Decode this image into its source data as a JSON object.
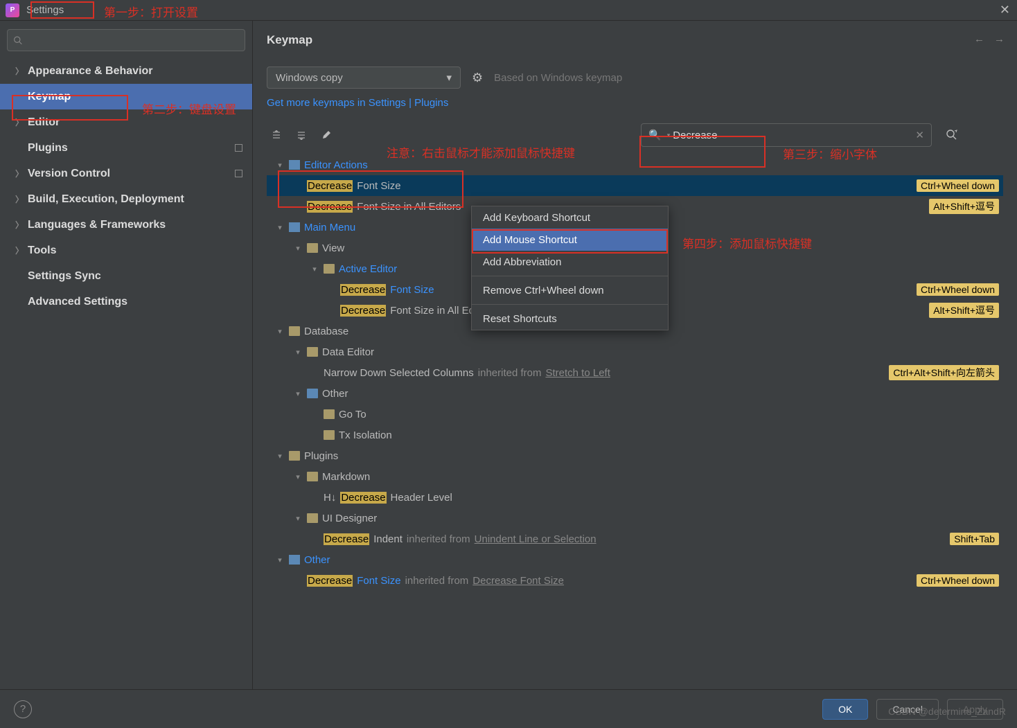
{
  "title": "Settings",
  "annotations": {
    "step1": "第一步：打开设置",
    "step2": "第二步：键盘设置",
    "step3": "第三步：缩小字体",
    "step4": "第四步：添加鼠标快捷键",
    "note": "注意：右击鼠标才能添加鼠标快捷键"
  },
  "sidebar": {
    "items": [
      {
        "label": "Appearance & Behavior",
        "exp": true,
        "bold": true
      },
      {
        "label": "Keymap",
        "exp": false,
        "bold": true,
        "selected": true,
        "pad": true
      },
      {
        "label": "Editor",
        "exp": true,
        "bold": true
      },
      {
        "label": "Plugins",
        "exp": false,
        "bold": true,
        "pad": true,
        "sq": true
      },
      {
        "label": "Version Control",
        "exp": true,
        "bold": true,
        "sq": true
      },
      {
        "label": "Build, Execution, Deployment",
        "exp": true,
        "bold": true
      },
      {
        "label": "Languages & Frameworks",
        "exp": true,
        "bold": true
      },
      {
        "label": "Tools",
        "exp": true,
        "bold": true
      },
      {
        "label": "Settings Sync",
        "exp": false,
        "bold": true,
        "pad": true
      },
      {
        "label": "Advanced Settings",
        "exp": false,
        "bold": true,
        "pad": true
      }
    ]
  },
  "content": {
    "heading": "Keymap",
    "select": "Windows copy",
    "based": "Based on Windows keymap",
    "link": "Get more keymaps in Settings | Plugins",
    "search": "Decrease"
  },
  "tree": [
    {
      "ind": 0,
      "tw": "▾",
      "icon": "cat",
      "text": "Editor Actions",
      "blue": true
    },
    {
      "ind": 1,
      "hl": "Decrease",
      "text": " Font Size",
      "sel": true,
      "short": "Ctrl+Wheel down"
    },
    {
      "ind": 1,
      "hl": "Decrease",
      "text": " Font Size in All Editors",
      "short": "Alt+Shift+逗号"
    },
    {
      "ind": 0,
      "tw": "▾",
      "icon": "cat",
      "text": "Main Menu",
      "blue": true
    },
    {
      "ind": 1,
      "tw": "▾",
      "icon": "folder",
      "text": "View"
    },
    {
      "ind": 2,
      "tw": "▾",
      "icon": "folder",
      "text": "Active Editor",
      "blue": true
    },
    {
      "ind": 3,
      "hl": "Decrease",
      "text2": " Font Size",
      "blue2": true,
      "short": "Ctrl+Wheel down"
    },
    {
      "ind": 3,
      "hl": "Decrease",
      "text": " Font Size in All Editors",
      "short": "Alt+Shift+逗号"
    },
    {
      "ind": 0,
      "tw": "▾",
      "icon": "folder",
      "text": "Database"
    },
    {
      "ind": 1,
      "tw": "▾",
      "icon": "folder",
      "text": "Data Editor"
    },
    {
      "ind": 2,
      "text": "Narrow Down Selected Columns ",
      "grey": "inherited from ",
      "under": "Stretch to Left",
      "short": "Ctrl+Alt+Shift+向左箭头"
    },
    {
      "ind": 1,
      "tw": "▾",
      "icon": "folder-blue",
      "text": "Other"
    },
    {
      "ind": 2,
      "icon": "folder",
      "text": "Go To"
    },
    {
      "ind": 2,
      "icon": "folder",
      "text": "Tx Isolation"
    },
    {
      "ind": 0,
      "tw": "▾",
      "icon": "folder",
      "text": "Plugins"
    },
    {
      "ind": 1,
      "tw": "▾",
      "icon": "folder",
      "text": "Markdown"
    },
    {
      "ind": 2,
      "pre": "H↓ ",
      "hl": "Decrease",
      "text": " Header Level"
    },
    {
      "ind": 1,
      "tw": "▾",
      "icon": "folder",
      "text": "UI Designer"
    },
    {
      "ind": 2,
      "hl": "Decrease",
      "text": " Indent ",
      "grey": "inherited from ",
      "under": "Unindent Line or Selection",
      "short": "Shift+Tab"
    },
    {
      "ind": 0,
      "tw": "▾",
      "icon": "cat",
      "text": "Other",
      "blue": true
    },
    {
      "ind": 1,
      "hl": "Decrease",
      "text2": " Font Size ",
      "blue2": true,
      "grey": "inherited from ",
      "under": "Decrease Font Size",
      "short": "Ctrl+Wheel down"
    }
  ],
  "ctx": {
    "items": [
      {
        "label": "Add Keyboard Shortcut"
      },
      {
        "label": "Add Mouse Shortcut",
        "sel": true
      },
      {
        "label": "Add Abbreviation"
      },
      {
        "sep": true
      },
      {
        "label": "Remove Ctrl+Wheel down"
      },
      {
        "sep": true
      },
      {
        "label": "Reset Shortcuts"
      }
    ]
  },
  "footer": {
    "ok": "OK",
    "cancel": "Cancel",
    "apply": "Apply"
  },
  "watermark": "CSDN @determine_ZandR"
}
